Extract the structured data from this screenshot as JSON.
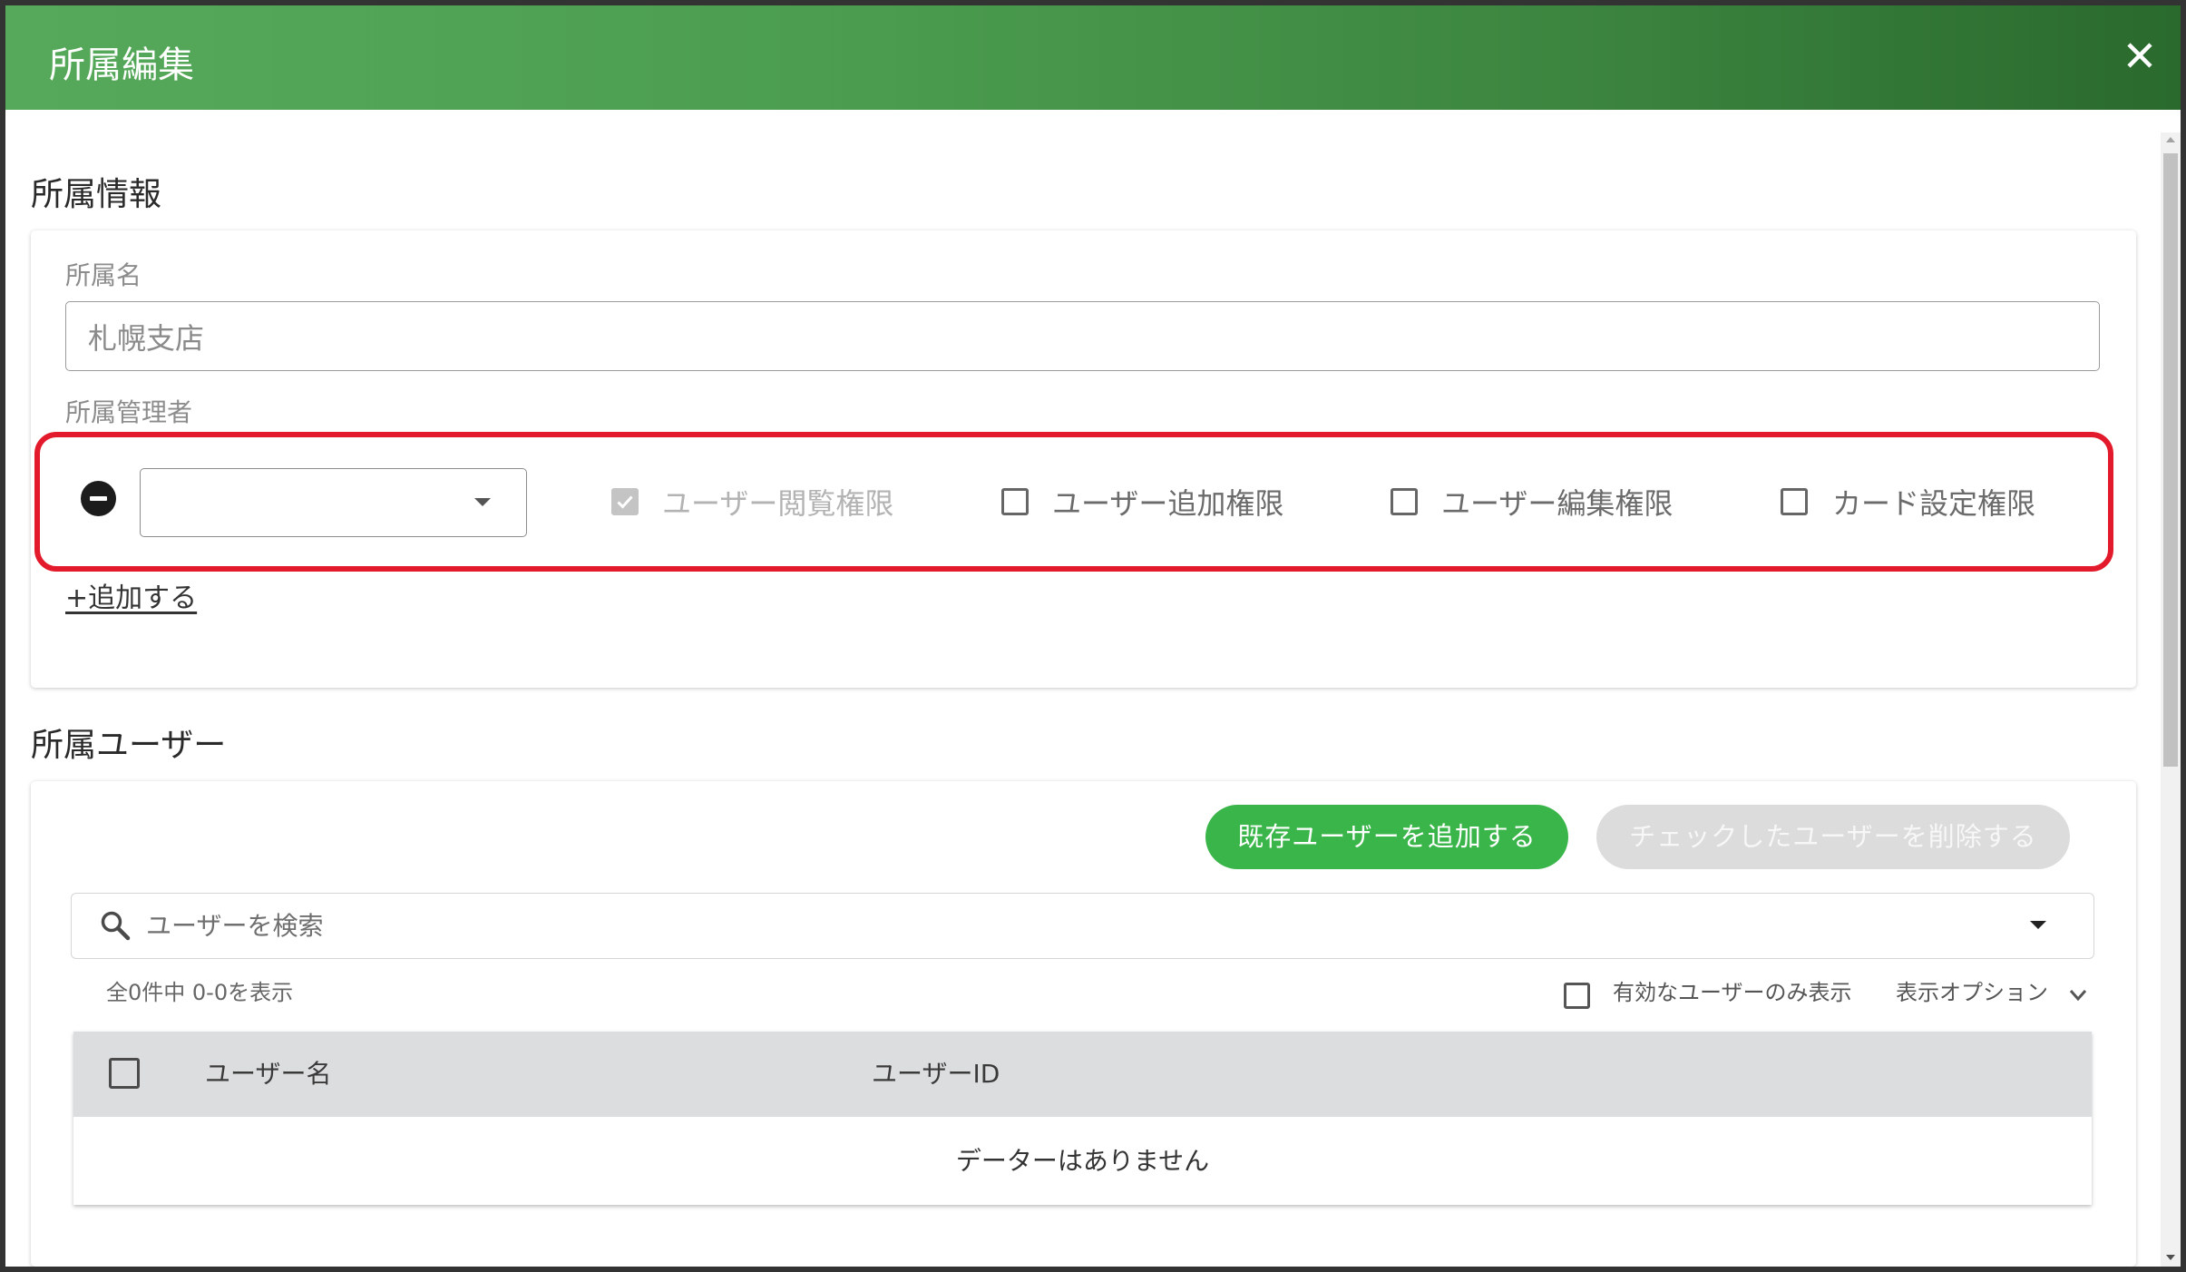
{
  "dialog": {
    "title": "所属編集"
  },
  "affiliation_info": {
    "heading": "所属情報",
    "name_label": "所属名",
    "name_value": "札幌支店",
    "manager_label": "所属管理者",
    "manager": {
      "permissions": [
        {
          "label": "ユーザー閲覧権限",
          "checked": true,
          "disabled": true
        },
        {
          "label": "ユーザー追加権限",
          "checked": false,
          "disabled": false
        },
        {
          "label": "ユーザー編集権限",
          "checked": false,
          "disabled": false
        },
        {
          "label": "カード設定権限",
          "checked": false,
          "disabled": false
        }
      ]
    },
    "add_link": "+追加する"
  },
  "affiliation_users": {
    "heading": "所属ユーザー",
    "add_existing_button": "既存ユーザーを追加する",
    "delete_checked_button": "チェックしたユーザーを削除する",
    "search_placeholder": "ユーザーを検索",
    "result_count": "全0件中 0-0を表示",
    "active_only_label": "有効なユーザーのみ表示",
    "active_only_checked": false,
    "display_options_label": "表示オプション",
    "table": {
      "select_all_checked": false,
      "columns": [
        "ユーザー名",
        "ユーザーID"
      ],
      "empty_message": "データーはありません"
    }
  },
  "icons": {
    "close": "close-icon",
    "remove_manager": "minus-circle-icon",
    "select_dropdown": "caret-down-icon",
    "search": "search-icon",
    "search_dropdown": "caret-down-icon",
    "display_options": "chevron-down-icon",
    "checkbox_checked": "check-icon"
  },
  "colors": {
    "header_start": "#56a95a",
    "header_end": "#2a6a2d",
    "accent": "#3ab54a",
    "highlight": "#e21a2c",
    "disabled_button": "#dcdcdc",
    "table_header_bg": "#dcdddf"
  }
}
